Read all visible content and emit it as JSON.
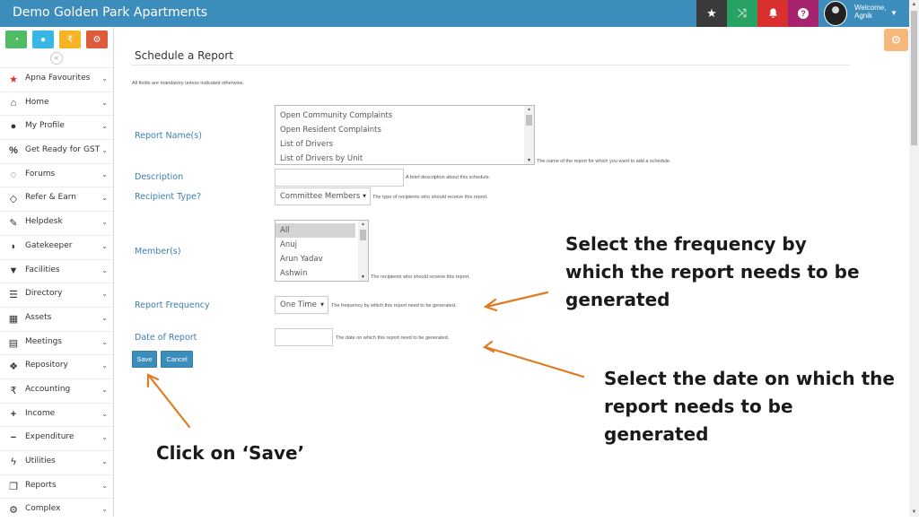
{
  "header": {
    "title": "Demo Golden Park Apartments",
    "welcome": "Welcome,",
    "username": "Agnik"
  },
  "sidebar": {
    "items": [
      {
        "label": "Apna Favourites",
        "icon": "star-icon"
      },
      {
        "label": "Home",
        "icon": "home-icon"
      },
      {
        "label": "My Profile",
        "icon": "user-icon"
      },
      {
        "label": "Get Ready for GST",
        "icon": "percent-icon"
      },
      {
        "label": "Forums",
        "icon": "chat-icon"
      },
      {
        "label": "Refer & Earn",
        "icon": "handshake-icon"
      },
      {
        "label": "Helpdesk",
        "icon": "wrench-icon"
      },
      {
        "label": "Gatekeeper",
        "icon": "shield-icon"
      },
      {
        "label": "Facilities",
        "icon": "filter-icon"
      },
      {
        "label": "Directory",
        "icon": "list-icon"
      },
      {
        "label": "Assets",
        "icon": "building-icon"
      },
      {
        "label": "Meetings",
        "icon": "calendar-icon"
      },
      {
        "label": "Repository",
        "icon": "dropbox-icon"
      },
      {
        "label": "Accounting",
        "icon": "rupee-icon"
      },
      {
        "label": "Income",
        "icon": "plus-icon"
      },
      {
        "label": "Expenditure",
        "icon": "minus-icon"
      },
      {
        "label": "Utilities",
        "icon": "bolt-icon"
      },
      {
        "label": "Reports",
        "icon": "copy-icon"
      },
      {
        "label": "Complex",
        "icon": "cog-icon"
      }
    ]
  },
  "page": {
    "title": "Schedule a Report",
    "mandatory_note": "All fields are mandatory unless indicated otherwise."
  },
  "form": {
    "report_name": {
      "label": "Report Name(s)",
      "options": [
        "Open Community Complaints",
        "Open Resident Complaints",
        "List of Drivers",
        "List of Drivers by Unit"
      ],
      "hint": "The name of the report for which you want to add a schedule."
    },
    "description": {
      "label": "Description",
      "value": "",
      "hint": "A brief description about this schedule."
    },
    "recipient_type": {
      "label": "Recipient Type?",
      "value": "Committee Members",
      "hint": "The type of recipients who should receive this report."
    },
    "members": {
      "label": "Member(s)",
      "options": [
        "All",
        "Anuj",
        "Arun Yadav",
        "Ashwin"
      ],
      "selected": "All",
      "hint": "The recipients who should receive this report."
    },
    "report_frequency": {
      "label": "Report Frequency",
      "value": "One Time",
      "hint": "The frequency by which this report need to be generated."
    },
    "date_of_report": {
      "label": "Date of Report",
      "value": "",
      "hint": "The date on which this report need to be generated."
    },
    "save_label": "Save",
    "cancel_label": "Cancel"
  },
  "annotations": {
    "frequency": "Select the frequency by which the report needs to be generated",
    "frequency_lines": [
      "Select the frequency by",
      "which the report needs to be",
      "generated"
    ],
    "date": "Select the date on which the report needs to be generated",
    "date_lines": [
      "Select the date on which the",
      "report needs to be generated"
    ],
    "save": "Click on ‘Save’",
    "arrow_color": "#e07b24"
  },
  "colors": {
    "header": "#3c8dbc",
    "label": "#3c7fb1",
    "button": "#3c8dbc"
  }
}
